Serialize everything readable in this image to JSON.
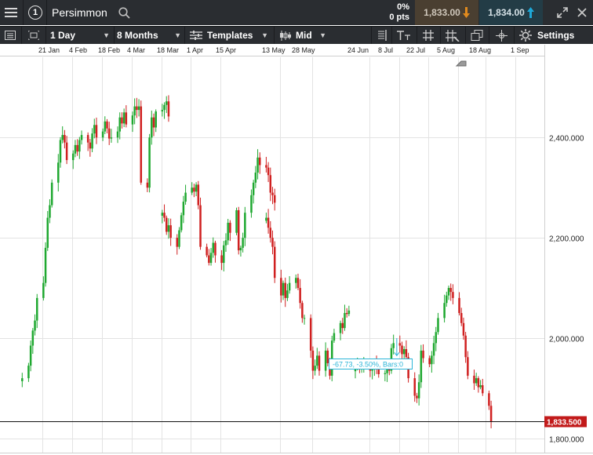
{
  "toolbar": {
    "instrument_number": "1",
    "instrument_name": "Persimmon",
    "change_pct": "0%",
    "change_pts": "0 pts",
    "sell_price": "1,833.00",
    "buy_price": "1,834.00",
    "interval": "1 Day",
    "range": "8 Months",
    "templates_label": "Templates",
    "price_type": "Mid",
    "settings_label": "Settings"
  },
  "colors": {
    "up": "#1fa830",
    "down": "#d02020",
    "toolbar_bg": "#2a2d31",
    "sell_bg": "#4a3f31",
    "buy_bg": "#233c46",
    "sell_arrow": "#e08a1e",
    "buy_arrow": "#1ea8d8",
    "price_tag": "#c21a1a",
    "measure": "#2bb5d8"
  },
  "icons": {
    "menu": "hamburger-icon",
    "search": "search-icon",
    "expand": "expand-icon",
    "close": "close-icon"
  },
  "chart_data": {
    "type": "candlestick",
    "title": "Persimmon",
    "interval": "1 Day",
    "x_tick_labels": [
      "21 Jan",
      "4 Feb",
      "18 Feb",
      "4 Mar",
      "18 Mar",
      "1 Apr",
      "15 Apr",
      "13 May",
      "28 May",
      "24 Jun",
      "8 Jul",
      "22 Jul",
      "5 Aug",
      "18 Aug",
      "1 Sep"
    ],
    "y_tick_labels": [
      "2,400.000",
      "2,200.000",
      "2,000.000",
      "1,800.000"
    ],
    "y_ticks": [
      2400,
      2200,
      2000,
      1800
    ],
    "ylim": [
      1770,
      2560
    ],
    "last_price": 1833.5,
    "last_price_label": "1,833.500",
    "measurement_label": "-67.73, -3.50%, Bars:0",
    "grid": true,
    "y_axis_position": "right",
    "segments": [
      {
        "start": "2019-01-11",
        "closes": [
          1920,
          1945,
          1985,
          2015,
          2035,
          2080,
          2110,
          2180,
          2240,
          2265,
          2310,
          2350,
          2395,
          2405,
          2390,
          2355,
          2368,
          2385,
          2372,
          2395,
          2405,
          2390,
          2378,
          2408,
          2425,
          2400,
          2412,
          2432,
          2418,
          2398,
          2400,
          2412,
          2440,
          2428,
          2450,
          2426,
          2444,
          2462,
          2455,
          2462,
          2310,
          2300,
          2400,
          2440,
          2420,
          2452,
          2455,
          2465,
          2472,
          2442
        ]
      },
      {
        "start": "2019-03-18",
        "closes": [
          2250,
          2240,
          2212,
          2225,
          2200,
          2182,
          2215,
          2245,
          2272,
          2290,
          2300,
          2292,
          2306,
          2265,
          2182,
          2165,
          2150,
          2170,
          2190,
          2165,
          2150,
          2185,
          2195,
          2230,
          2210,
          2255,
          2175,
          2180,
          2200,
          2250,
          2285,
          2310,
          2330,
          2360,
          2345,
          2340,
          2325,
          2290,
          2285,
          2270
        ]
      },
      {
        "start": "2019-05-06",
        "closes": [
          2240,
          2220,
          2200,
          2182,
          2120,
          2085,
          2110,
          2080,
          2095,
          2110,
          2120,
          2100,
          2070,
          2040,
          2040,
          1975,
          1935,
          1945,
          1965,
          1935,
          1975,
          1950,
          1925,
          1995,
          2010,
          2030,
          2020,
          2050,
          2048,
          2055
        ]
      },
      {
        "start": "2019-06-17",
        "closes": [
          1940,
          1945,
          1938,
          1942,
          1948,
          1935,
          1942,
          1950,
          1938,
          1928,
          1930,
          1942,
          1935,
          1980,
          1990,
          1985,
          1968,
          1978,
          1962,
          1920,
          1885,
          1880,
          1912,
          1975,
          1960,
          1948,
          1965,
          1990,
          2012,
          2040,
          2070,
          2085,
          2100,
          2092,
          2080,
          2050,
          2030,
          2005,
          1962,
          1925,
          1910,
          1920,
          1902,
          1906,
          1890,
          1865,
          1833.5
        ]
      }
    ]
  }
}
